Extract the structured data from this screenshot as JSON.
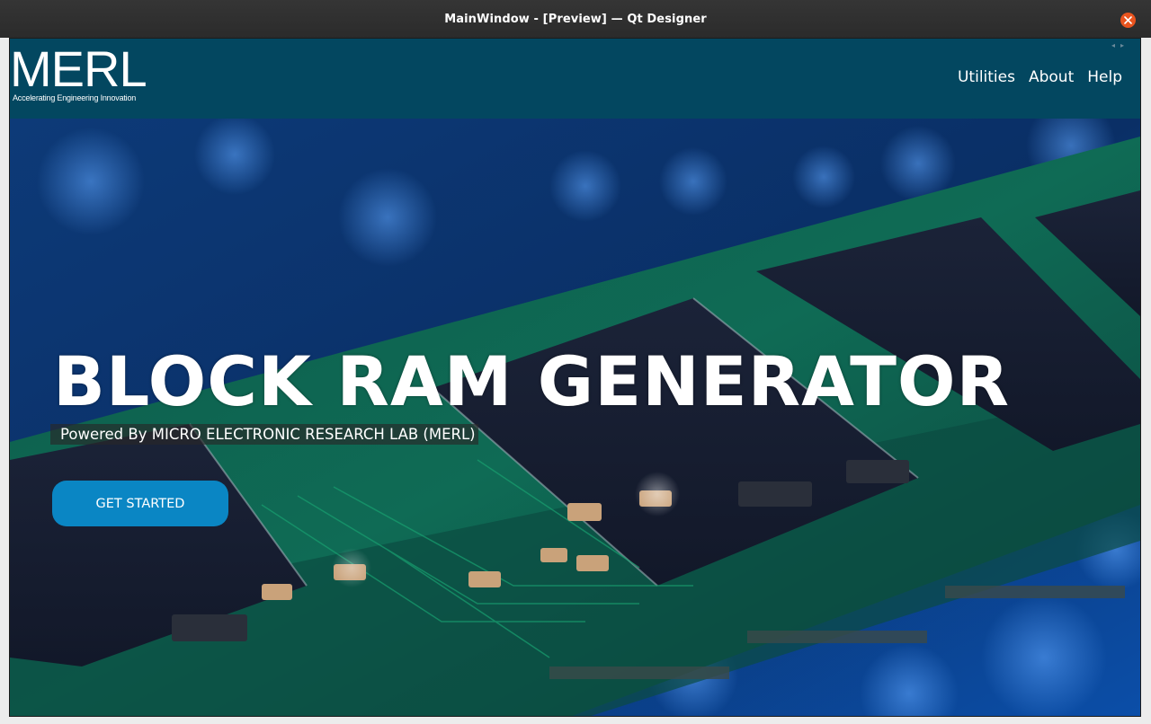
{
  "window": {
    "title": "MainWindow - [Preview] — Qt Designer",
    "close_icon": "close-icon"
  },
  "navbar": {
    "logo_text": "MERL",
    "logo_tagline": "Accelerating Engineering Innovation",
    "menu": [
      {
        "label": "Utilities"
      },
      {
        "label": "About"
      },
      {
        "label": "Help"
      }
    ]
  },
  "hero": {
    "title": "BLOCK RAM GENERATOR",
    "subtitle": "Powered By MICRO ELECTRONIC RESEARCH LAB (MERL)",
    "cta_label": "GET STARTED",
    "background": "circuit-board-image"
  },
  "colors": {
    "navbar_bg": "#034760",
    "cta_bg": "#0a86c4",
    "titlebar_bg": "#2b2b2b",
    "close_bg": "#e9541f"
  }
}
